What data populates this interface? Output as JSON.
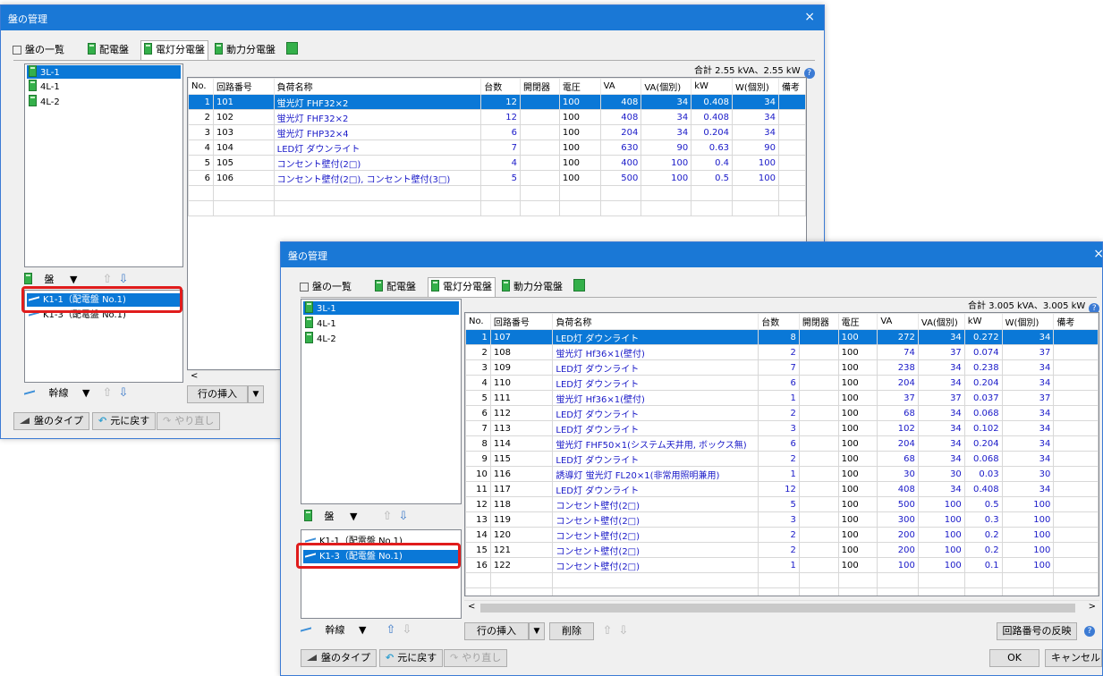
{
  "back": {
    "title": "盤の管理",
    "close": "×",
    "tabs": [
      "盤の一覧",
      "配電盤",
      "電灯分電盤",
      "動力分電盤"
    ],
    "tree": [
      "3L-1",
      "4L-1",
      "4L-2"
    ],
    "summary": "合計 2.55 kVA、2.55 kW",
    "columns": [
      "No.",
      "回路番号",
      "負荷名称",
      "台数",
      "開閉器",
      "電圧",
      "VA",
      "VA(個別)",
      "kW",
      "W(個別)",
      "備考"
    ],
    "rows": [
      [
        "1",
        "101",
        "蛍光灯 FHF32×2",
        "12",
        "",
        "100",
        "408",
        "34",
        "0.408",
        "34",
        ""
      ],
      [
        "2",
        "102",
        "蛍光灯 FHF32×2",
        "12",
        "",
        "100",
        "408",
        "34",
        "0.408",
        "34",
        ""
      ],
      [
        "3",
        "103",
        "蛍光灯 FHP32×4",
        "6",
        "",
        "100",
        "204",
        "34",
        "0.204",
        "34",
        ""
      ],
      [
        "4",
        "104",
        "LED灯 ダウンライト",
        "7",
        "",
        "100",
        "630",
        "90",
        "0.63",
        "90",
        ""
      ],
      [
        "5",
        "105",
        "コンセント壁付(2□)",
        "4",
        "",
        "100",
        "400",
        "100",
        "0.4",
        "100",
        ""
      ],
      [
        "6",
        "106",
        "コンセント壁付(2□), コンセント壁付(3□)",
        "5",
        "",
        "100",
        "500",
        "100",
        "0.5",
        "100",
        ""
      ]
    ],
    "panel_label": "盤",
    "feeders": [
      "K1-1（配電盤 No.1)",
      "K1-3（配電盤 No.1)"
    ],
    "trunk_label": "幹線",
    "insert_row": "行の挿入",
    "bottom": {
      "type": "盤のタイプ",
      "undo": "元に戻す",
      "redo": "やり直し"
    }
  },
  "front": {
    "title": "盤の管理",
    "close": "×",
    "tabs": [
      "盤の一覧",
      "配電盤",
      "電灯分電盤",
      "動力分電盤"
    ],
    "tree": [
      "3L-1",
      "4L-1",
      "4L-2"
    ],
    "summary": "合計 3.005 kVA、3.005 kW",
    "columns": [
      "No.",
      "回路番号",
      "負荷名称",
      "台数",
      "開閉器",
      "電圧",
      "VA",
      "VA(個別)",
      "kW",
      "W(個別)",
      "備考"
    ],
    "rows": [
      [
        "1",
        "107",
        "LED灯 ダウンライト",
        "8",
        "",
        "100",
        "272",
        "34",
        "0.272",
        "34",
        ""
      ],
      [
        "2",
        "108",
        "蛍光灯 Hf36×1(壁付)",
        "2",
        "",
        "100",
        "74",
        "37",
        "0.074",
        "37",
        ""
      ],
      [
        "3",
        "109",
        "LED灯 ダウンライト",
        "7",
        "",
        "100",
        "238",
        "34",
        "0.238",
        "34",
        ""
      ],
      [
        "4",
        "110",
        "LED灯 ダウンライト",
        "6",
        "",
        "100",
        "204",
        "34",
        "0.204",
        "34",
        ""
      ],
      [
        "5",
        "111",
        "蛍光灯 Hf36×1(壁付)",
        "1",
        "",
        "100",
        "37",
        "37",
        "0.037",
        "37",
        ""
      ],
      [
        "6",
        "112",
        "LED灯 ダウンライト",
        "2",
        "",
        "100",
        "68",
        "34",
        "0.068",
        "34",
        ""
      ],
      [
        "7",
        "113",
        "LED灯 ダウンライト",
        "3",
        "",
        "100",
        "102",
        "34",
        "0.102",
        "34",
        ""
      ],
      [
        "8",
        "114",
        "蛍光灯 FHF50×1(システム天井用, ボックス無)",
        "6",
        "",
        "100",
        "204",
        "34",
        "0.204",
        "34",
        ""
      ],
      [
        "9",
        "115",
        "LED灯 ダウンライト",
        "2",
        "",
        "100",
        "68",
        "34",
        "0.068",
        "34",
        ""
      ],
      [
        "10",
        "116",
        "誘導灯 蛍光灯 FL20×1(非常用照明兼用)",
        "1",
        "",
        "100",
        "30",
        "30",
        "0.03",
        "30",
        ""
      ],
      [
        "11",
        "117",
        "LED灯 ダウンライト",
        "12",
        "",
        "100",
        "408",
        "34",
        "0.408",
        "34",
        ""
      ],
      [
        "12",
        "118",
        "コンセント壁付(2□)",
        "5",
        "",
        "100",
        "500",
        "100",
        "0.5",
        "100",
        ""
      ],
      [
        "13",
        "119",
        "コンセント壁付(2□)",
        "3",
        "",
        "100",
        "300",
        "100",
        "0.3",
        "100",
        ""
      ],
      [
        "14",
        "120",
        "コンセント壁付(2□)",
        "2",
        "",
        "100",
        "200",
        "100",
        "0.2",
        "100",
        ""
      ],
      [
        "15",
        "121",
        "コンセント壁付(2□)",
        "2",
        "",
        "100",
        "200",
        "100",
        "0.2",
        "100",
        ""
      ],
      [
        "16",
        "122",
        "コンセント壁付(2□)",
        "1",
        "",
        "100",
        "100",
        "100",
        "0.1",
        "100",
        ""
      ]
    ],
    "panel_label": "盤",
    "feeders": [
      "K1-1（配電盤 No.1)",
      "K1-3（配電盤 No.1)"
    ],
    "trunk_label": "幹線",
    "insert_row": "行の挿入",
    "delete": "削除",
    "reflect": "回路番号の反映",
    "bottom": {
      "type": "盤のタイプ",
      "undo": "元に戻す",
      "redo": "やり直し",
      "ok": "OK",
      "cancel": "キャンセル"
    }
  }
}
